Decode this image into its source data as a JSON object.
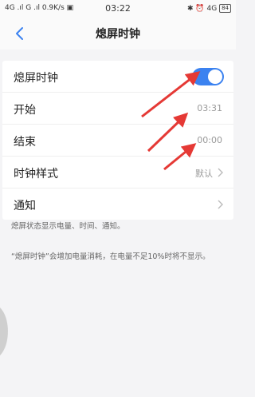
{
  "status_bar": {
    "left": "4G .ıl G .ıl 0.9K/s ▣",
    "time": "03:22",
    "right_icons": "✱ ⏰ 4G",
    "battery": "84"
  },
  "header": {
    "title": "熄屏时钟"
  },
  "settings": {
    "aod_label": "熄屏时钟",
    "aod_enabled": true,
    "start_label": "开始",
    "start_value": "03:31",
    "end_label": "结束",
    "end_value": "00:00",
    "style_label": "时钟样式",
    "style_value": "默认",
    "notify_label": "通知"
  },
  "notes": {
    "info": "熄屏状态显示电量、时间、通知。",
    "warning": "“熄屏时钟”会增加电量消耗，在电量不足10%时将不显示。"
  },
  "colors": {
    "accent": "#3b82f0",
    "annotation_arrow": "#e53935"
  }
}
